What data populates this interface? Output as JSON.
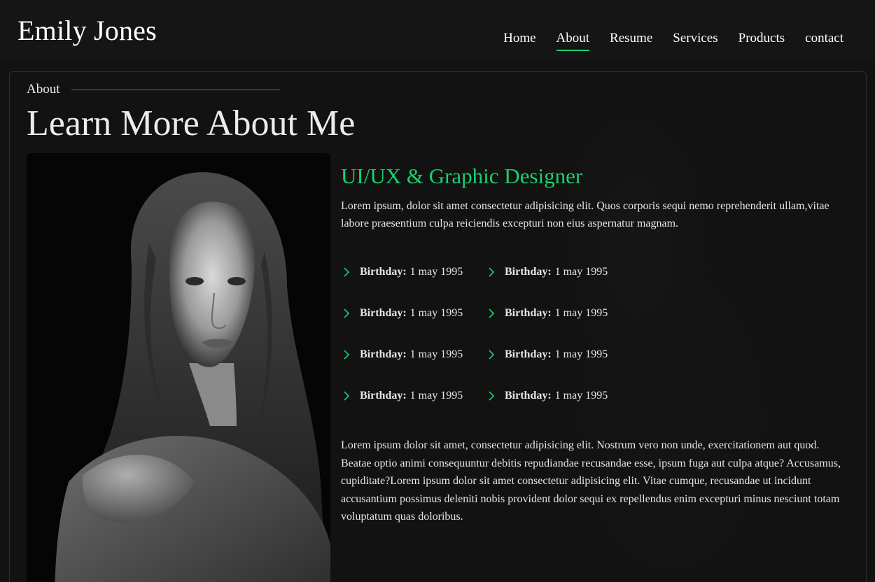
{
  "header": {
    "logo": "Emily Jones",
    "nav": [
      {
        "label": "Home",
        "active": false
      },
      {
        "label": "About",
        "active": true
      },
      {
        "label": "Resume",
        "active": false
      },
      {
        "label": "Services",
        "active": false
      },
      {
        "label": "Products",
        "active": false
      },
      {
        "label": "contact",
        "active": false
      }
    ]
  },
  "about": {
    "section_label": "About",
    "title": "Learn More About Me",
    "role": "UI/UX & Graphic Designer",
    "intro": "Lorem ipsum, dolor sit amet consectetur adipisicing elit. Quos corporis sequi nemo reprehenderit ullam,vitae labore praesentium culpa reiciendis excepturi non eius aspernatur magnam.",
    "facts": [
      {
        "label": "Birthday:",
        "value": "1 may 1995"
      },
      {
        "label": "Birthday:",
        "value": "1 may 1995"
      },
      {
        "label": "Birthday:",
        "value": "1 may 1995"
      },
      {
        "label": "Birthday:",
        "value": "1 may 1995"
      },
      {
        "label": "Birthday:",
        "value": "1 may 1995"
      },
      {
        "label": "Birthday:",
        "value": "1 may 1995"
      },
      {
        "label": "Birthday:",
        "value": "1 may 1995"
      },
      {
        "label": "Birthday:",
        "value": "1 may 1995"
      }
    ],
    "body": "Lorem ipsum dolor sit amet, consectetur adipisicing elit. Nostrum vero non unde, exercitationem aut quod. Beatae optio animi consequuntur debitis repudiandae recusandae esse, ipsum fuga aut culpa atque? Accusamus, cupiditate?Lorem ipsum dolor sit amet consectetur adipisicing elit. Vitae cumque, recusandae ut incidunt accusantium possimus deleniti nobis provident dolor sequi ex repellendus enim excepturi minus nesciunt totam voluptatum quas doloribus."
  },
  "colors": {
    "accent": "#18d26e",
    "background": "#121212",
    "text": "#e6e6e6"
  },
  "icons": {
    "fact_bullet": "chevron-right-icon",
    "portrait": "portrait-photo"
  }
}
